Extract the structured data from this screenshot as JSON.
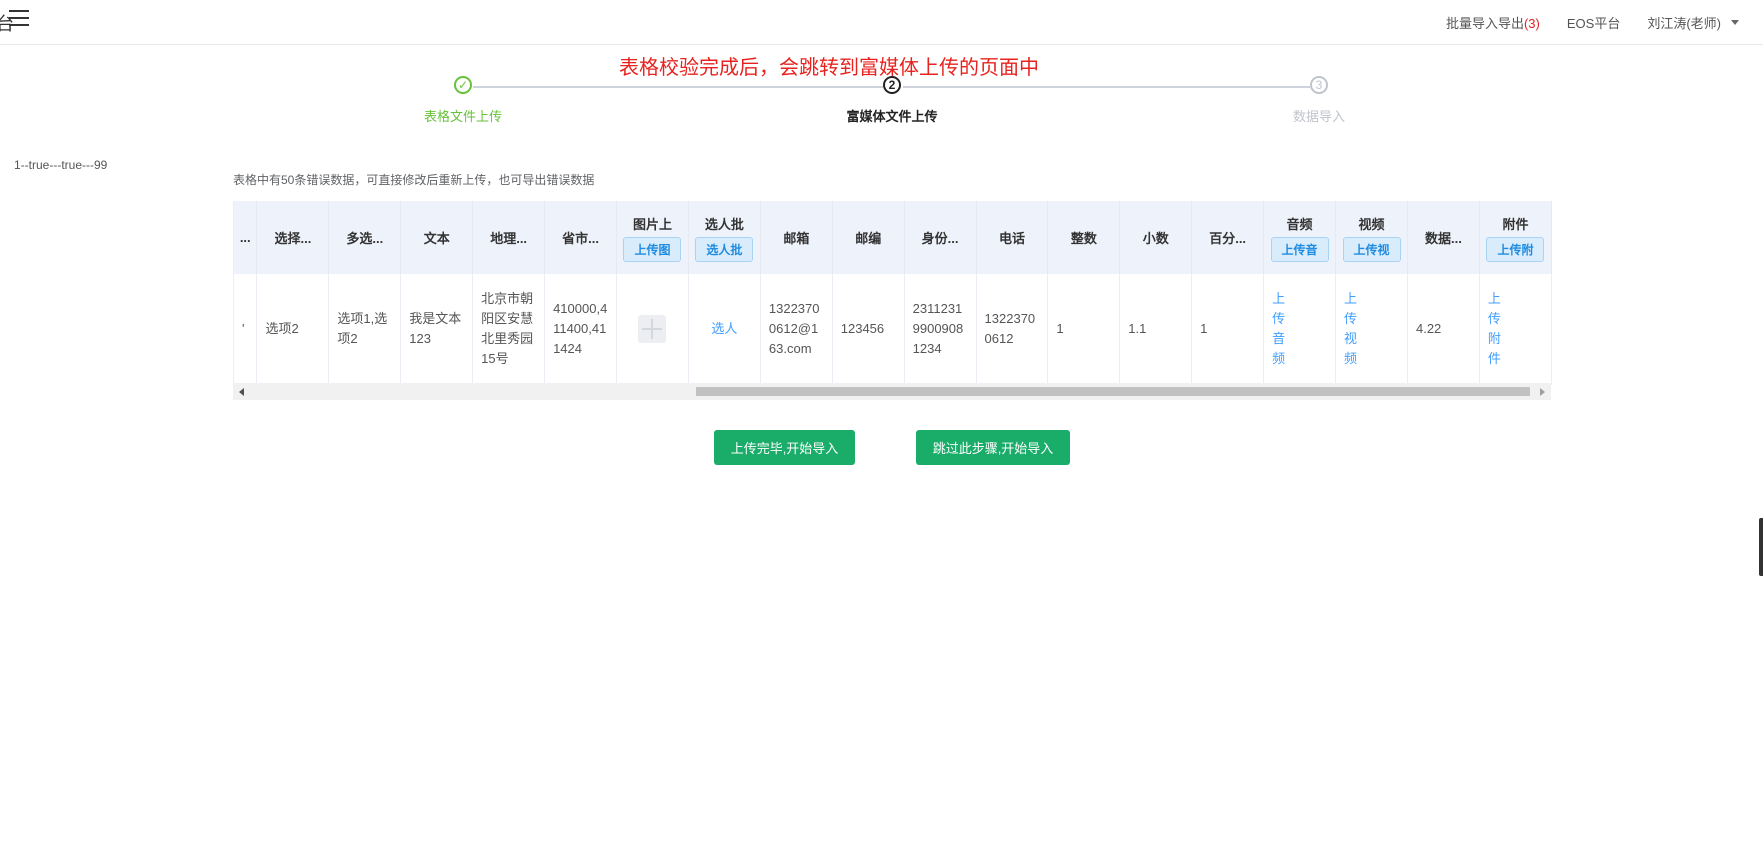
{
  "header": {
    "logo_fragment": "台",
    "nav": [
      {
        "label": "批量导入导出",
        "count": "(3)"
      },
      {
        "label": "EOS平台"
      }
    ],
    "user": "刘江涛(老师)"
  },
  "annotation": "表格校验完成后，会跳转到富媒体上传的页面中",
  "steps": [
    {
      "index": "✓",
      "label": "表格文件上传",
      "status": "done"
    },
    {
      "index": "2",
      "label": "富媒体文件上传",
      "status": "active"
    },
    {
      "index": "3",
      "label": "数据导入",
      "status": "wait"
    }
  ],
  "debug_text": "1--true---true---99",
  "error_summary": "表格中有50条错误数据，可直接修改后重新上传，也可导出错误数据",
  "table": {
    "columns": [
      {
        "title": "...",
        "button": ""
      },
      {
        "title": "选择...",
        "button": ""
      },
      {
        "title": "多选...",
        "button": ""
      },
      {
        "title": "文本",
        "button": ""
      },
      {
        "title": "地理...",
        "button": ""
      },
      {
        "title": "省市...",
        "button": ""
      },
      {
        "title": "图片上",
        "button": "上传图"
      },
      {
        "title": "选人批",
        "button": "选人批"
      },
      {
        "title": "邮箱",
        "button": ""
      },
      {
        "title": "邮编",
        "button": ""
      },
      {
        "title": "身份...",
        "button": ""
      },
      {
        "title": "电话",
        "button": ""
      },
      {
        "title": "整数",
        "button": ""
      },
      {
        "title": "小数",
        "button": ""
      },
      {
        "title": "百分...",
        "button": ""
      },
      {
        "title": "音频",
        "button": "上传音"
      },
      {
        "title": "视频",
        "button": "上传视"
      },
      {
        "title": "数据...",
        "button": ""
      },
      {
        "title": "附件",
        "button": "上传附"
      }
    ],
    "row": {
      "c0": "'",
      "c1": "选项2",
      "c2": "选项1,选项2",
      "c3": "我是文本123",
      "c4": "北京市朝阳区安慧北里秀园15号",
      "c5": "410000,411400,411424",
      "c7": "选人",
      "c8": "13223700612@163.com",
      "c9": "123456",
      "c10": "231123199009081234",
      "c11": "13223700612",
      "c12": "1",
      "c13": "1.1",
      "c14": "1",
      "c15": "上传音频",
      "c16": "上传视频",
      "c17": "4.22",
      "c18": "上传附件"
    }
  },
  "buttons": {
    "upload_done": "上传完毕,开始导入",
    "skip": "跳过此步骤,开始导入"
  }
}
